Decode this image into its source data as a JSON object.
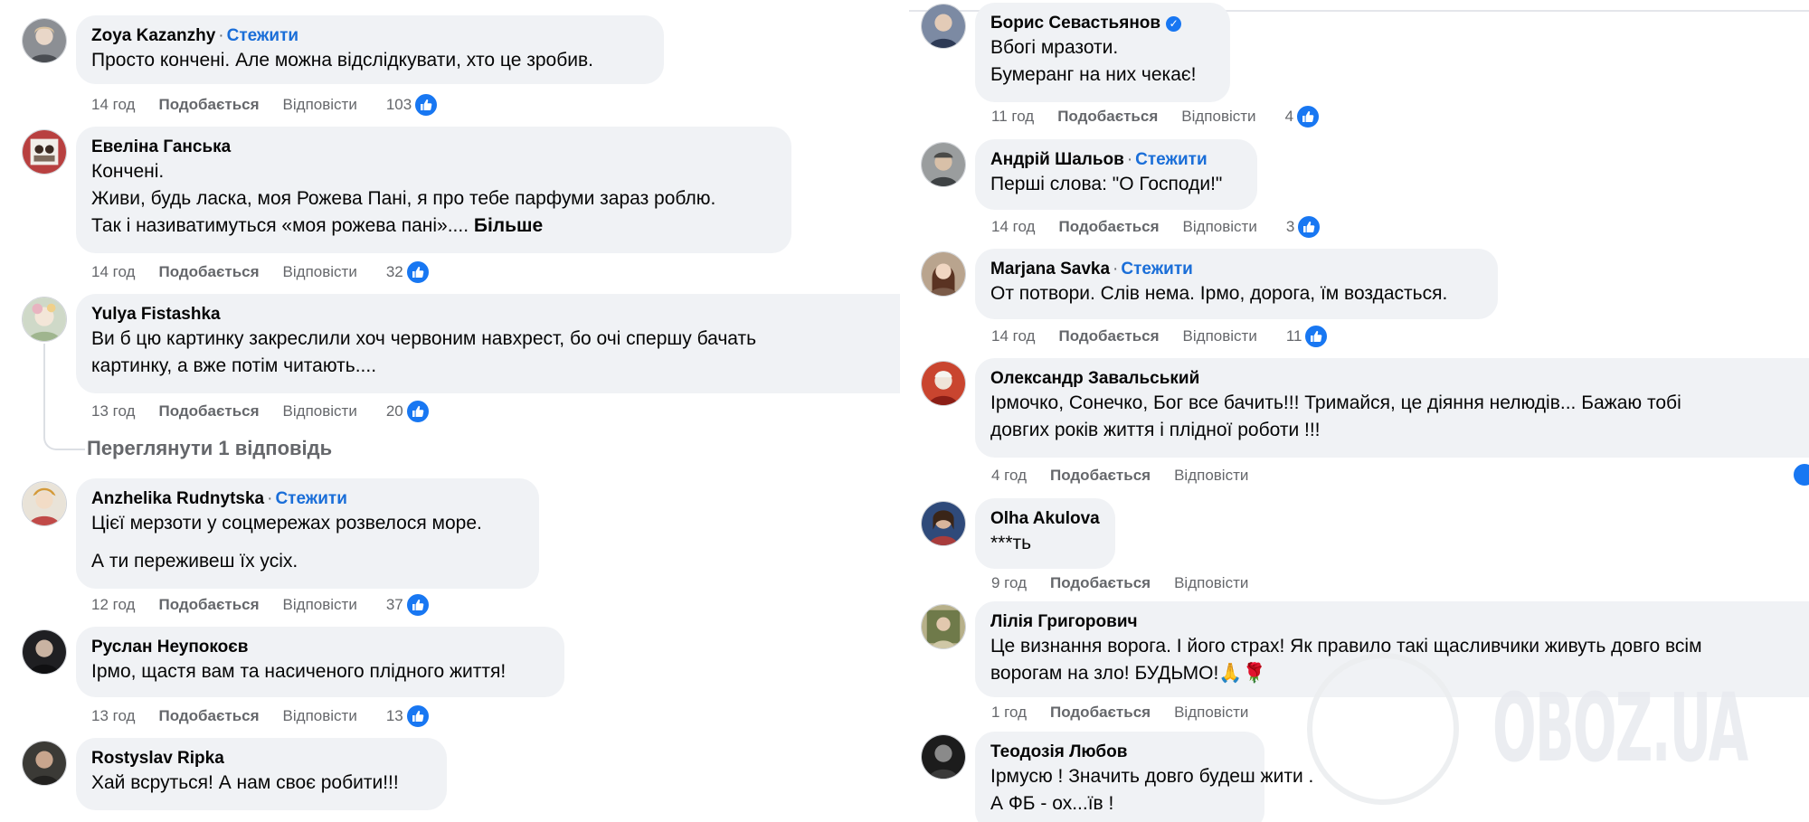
{
  "left_comments": [
    {
      "author": "Zoya Kazanzhy",
      "follow": "Стежити",
      "lines": [
        "Просто кончені. Але можна відслідкувати, хто це зробив."
      ],
      "time": "14 год",
      "like": "Подобається",
      "reply": "Відповісти",
      "reactions": "103"
    },
    {
      "author": "Евеліна Ганська",
      "lines": [
        "Кончені.",
        "Живи, будь ласка, моя Рожева Пані, я про тебе парфуми зараз роблю.",
        "Так і називатимуться «моя рожева пані»...."
      ],
      "more": "Більше",
      "time": "14 год",
      "like": "Подобається",
      "reply": "Відповісти",
      "reactions": "32"
    },
    {
      "author": "Yulya Fistashka",
      "lines": [
        "Ви б цю картинку закреслили хоч червоним навхрест, бо очі спершу бачать",
        "картинку, а вже потім читають...."
      ],
      "time": "13 год",
      "like": "Подобається",
      "reply": "Відповісти",
      "reactions": "20",
      "view_replies": "Переглянути 1 відповідь"
    },
    {
      "author": "Anzhelika Rudnytska",
      "follow": "Стежити",
      "lines": [
        "Цієї мерзоти у соцмережах розвелося море."
      ],
      "lines2": [
        "А ти переживеш їх усіх."
      ],
      "time": "12 год",
      "like": "Подобається",
      "reply": "Відповісти",
      "reactions": "37"
    },
    {
      "author": "Руслан Неупокоєв",
      "lines": [
        "Ірмо, щастя вам та насиченого плідного життя!"
      ],
      "time": "13 год",
      "like": "Подобається",
      "reply": "Відповісти",
      "reactions": "13"
    },
    {
      "author": "Rostyslav Ripka",
      "lines": [
        "Хай всруться! А нам своє робити!!!"
      ]
    }
  ],
  "right_comments": [
    {
      "author": "Борис Севастьянов",
      "verified": true,
      "lines": [
        "Вбогі мразоти.",
        "Бумеранг на них чекає!"
      ],
      "time": "11 год",
      "like": "Подобається",
      "reply": "Відповісти",
      "reactions": "4"
    },
    {
      "author": "Андрій Шальов",
      "follow": "Стежити",
      "lines": [
        "Перші слова: \"О Господи!\""
      ],
      "time": "14 год",
      "like": "Подобається",
      "reply": "Відповісти",
      "reactions": "3"
    },
    {
      "author": "Marjana Savka",
      "follow": "Стежити",
      "lines": [
        "От потвори. Слів нема. Ірмо, дорога, їм воздасться."
      ],
      "time": "14 год",
      "like": "Подобається",
      "reply": "Відповісти",
      "reactions": "11"
    },
    {
      "author": "Олександр Завальський",
      "lines": [
        "Ірмочко, Сонечко, Бог все бачить!!! Тримайся, це діяння нелюдів... Бажаю тобі",
        "довгих років життя і плідної роботи !!!"
      ],
      "time": "4 год",
      "like": "Подобається",
      "reply": "Відповісти"
    },
    {
      "author": "Olha Akulova",
      "lines": [
        "***ть"
      ],
      "time": "9 год",
      "like": "Подобається",
      "reply": "Відповісти"
    },
    {
      "author": "Лілія Григорович",
      "lines": [
        "Це визнання ворога. І його страх! Як правило такі щасливчики живуть довго всім",
        "ворогам на зло! БУДЬМО!🙏🌹"
      ],
      "time": "1 год",
      "like": "Подобається",
      "reply": "Відповісти"
    },
    {
      "author": "Теодозія Любов",
      "lines": [
        "Ірмусю ! Значить довго будеш жити .",
        "А ФБ - ох...їв !"
      ]
    }
  ],
  "watermark": {
    "text": "OBOZ.UA"
  },
  "colors": {
    "link": "#1a6ed8",
    "like_blue": "#1877f2",
    "bubble": "#f0f2f5",
    "meta": "#65676b"
  }
}
